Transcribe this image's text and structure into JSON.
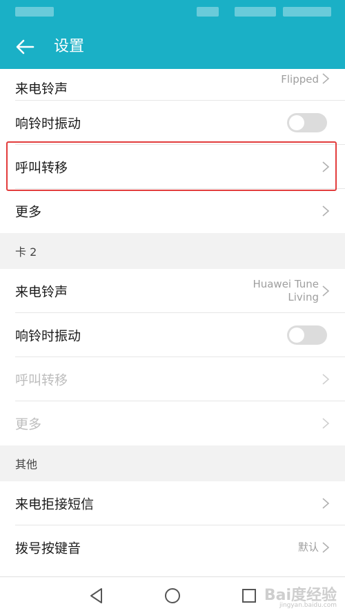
{
  "header": {
    "title": "设置"
  },
  "card1_rows": [
    {
      "label": "来电铃声",
      "value": "Flipped",
      "type": "chevron"
    },
    {
      "label": "响铃时振动",
      "type": "toggle",
      "on": false
    },
    {
      "label": "呼叫转移",
      "type": "chevron"
    },
    {
      "label": "更多",
      "type": "chevron"
    }
  ],
  "section2": {
    "label": "卡 2"
  },
  "card2_rows": [
    {
      "label": "来电铃声",
      "value_line1": "Huawei Tune",
      "value_line2": "Living",
      "type": "chevron"
    },
    {
      "label": "响铃时振动",
      "type": "toggle",
      "on": false
    },
    {
      "label": "呼叫转移",
      "type": "chevron",
      "disabled": true
    },
    {
      "label": "更多",
      "type": "chevron",
      "disabled": true
    }
  ],
  "section3": {
    "label": "其他"
  },
  "other_rows": [
    {
      "label": "来电拒接短信",
      "type": "chevron"
    },
    {
      "label": "拨号按键音",
      "value": "默认",
      "type": "chevron"
    }
  ],
  "watermark": {
    "main": "Bai度经验",
    "sub": "jingyan.baidu.com"
  },
  "colors": {
    "accent": "#1ab0c6",
    "highlight": "#e23b3b"
  }
}
